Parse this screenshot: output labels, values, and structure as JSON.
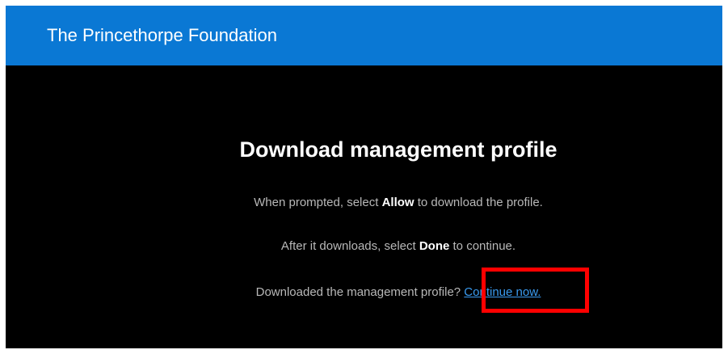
{
  "header": {
    "title": "The Princethorpe Foundation"
  },
  "main": {
    "title": "Download management profile",
    "instruction_1": {
      "before": "When prompted, select ",
      "bold": "Allow",
      "after": " to download the profile."
    },
    "instruction_2": {
      "before": "After it downloads, select ",
      "bold": "Done",
      "after": " to continue."
    },
    "question": {
      "text": "Downloaded the management profile? ",
      "link_label": "Continue now."
    }
  },
  "colors": {
    "header_bg": "#0a78d4",
    "page_bg": "#000000",
    "link": "#3a9bf0",
    "highlight": "#ff0000"
  }
}
